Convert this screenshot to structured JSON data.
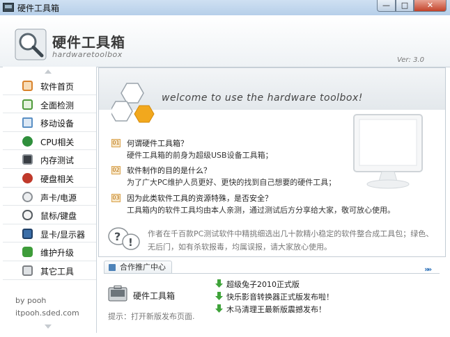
{
  "window": {
    "title": "硬件工具箱",
    "minimize": "—",
    "maximize": "□",
    "close": "✕"
  },
  "header": {
    "brand_cn": "硬件工具箱",
    "brand_en": "hardwaretoolbox",
    "version": "Ver: 3.0"
  },
  "sidebar": {
    "items": [
      {
        "label": "软件首页",
        "icon": "home-icon",
        "color": "#d9822b"
      },
      {
        "label": "全面检测",
        "icon": "checklist-icon",
        "color": "#4e9a3a"
      },
      {
        "label": "移动设备",
        "icon": "usb-device-icon",
        "color": "#5a8fc4"
      },
      {
        "label": "CPU相关",
        "icon": "cpu-icon",
        "color": "#2f8f3c"
      },
      {
        "label": "内存测试",
        "icon": "memory-icon",
        "color": "#3a3f45"
      },
      {
        "label": "硬盘相关",
        "icon": "harddisk-icon",
        "color": "#c0392b"
      },
      {
        "label": "声卡/电源",
        "icon": "sound-icon",
        "color": "#8a8f94"
      },
      {
        "label": "鼠标/键盘",
        "icon": "mouse-icon",
        "color": "#555b60"
      },
      {
        "label": "显卡/显示器",
        "icon": "monitor-icon",
        "color": "#3b6ea8"
      },
      {
        "label": "维护升级",
        "icon": "update-icon",
        "color": "#3e9c3a"
      },
      {
        "label": "其它工具",
        "icon": "tools-icon",
        "color": "#7c7f83"
      }
    ],
    "footer_by": "by pooh",
    "footer_site": "itpooh.sded.com"
  },
  "main": {
    "welcome": "welcome to use the hardware toolbox!",
    "qa": [
      {
        "num": "01",
        "q": "何谓硬件工具箱？",
        "a": "硬件工具箱的前身为超级USB设备工具箱；"
      },
      {
        "num": "02",
        "q": "软件制作的目的是什么？",
        "a": "为了广大PC维护人员更好、更快的找到自己想要的硬件工具；"
      },
      {
        "num": "03",
        "q": "因为此类软件工具的资源特殊，是否安全？",
        "a": "工具箱内的软件工具均由本人亲测，通过测试后方分享给大家，敬可放心使用。"
      }
    ],
    "disclaimer": "作者在千百款PC测试软件中精挑细选出几十款精小稳定的软件整合成工具包；绿色、无后门，如有杀软报毒，均属误报，请大家放心使用。"
  },
  "partner": {
    "tab_label": "合作推广中心",
    "more": "»»",
    "product_name": "硬件工具箱",
    "hint": "提示：打开新版发布页面.",
    "news": [
      "超级兔子2010正式版",
      "快乐影音转换器正式版发布啦！",
      "木马清理王最新版震撼发布！"
    ]
  },
  "colors": {
    "accent_orange": "#f0a020",
    "hex_white": "#ffffff",
    "news_arrow_green": "#3fa33a"
  }
}
